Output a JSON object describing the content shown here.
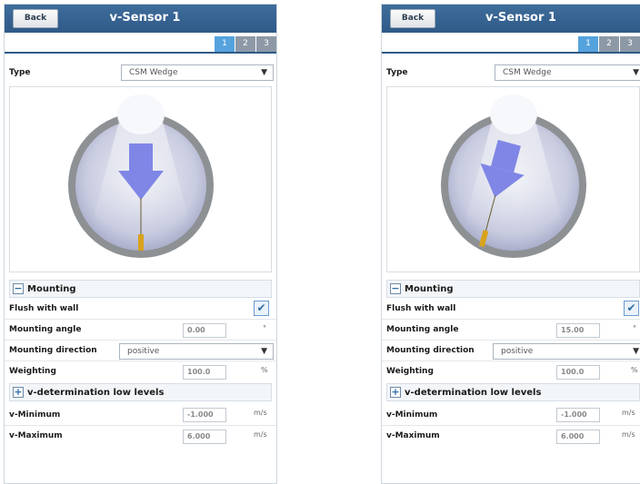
{
  "panels": [
    {
      "back_label": "Back",
      "title": "v-Sensor 1",
      "tabs": [
        "1",
        "2",
        "3"
      ],
      "type_label": "Type",
      "type_value": "CSM Wedge",
      "diagram": {
        "beam_angle_deg": 0
      },
      "mounting_section": "Mounting",
      "flush_label": "Flush with wall",
      "flush_checked": "✔",
      "angle_label": "Mounting angle",
      "angle_value": "0.00",
      "angle_unit": "°",
      "direction_label": "Mounting direction",
      "direction_value": "positive",
      "weighting_label": "Weighting",
      "weighting_value": "100.0",
      "weighting_unit": "%",
      "vdet_section": "v-determination low levels",
      "vmin_label": "v-Minimum",
      "vmin_value": "-1.000",
      "vmin_unit": "m/s",
      "vmax_label": "v-Maximum",
      "vmax_value": "6.000",
      "vmax_unit": "m/s"
    },
    {
      "back_label": "Back",
      "title": "v-Sensor 1",
      "tabs": [
        "1",
        "2",
        "3"
      ],
      "type_label": "Type",
      "type_value": "CSM Wedge",
      "diagram": {
        "beam_angle_deg": 15
      },
      "mounting_section": "Mounting",
      "flush_label": "Flush with wall",
      "flush_checked": "✔",
      "angle_label": "Mounting angle",
      "angle_value": "15.00",
      "angle_unit": "°",
      "direction_label": "Mounting direction",
      "direction_value": "positive",
      "weighting_label": "Weighting",
      "weighting_value": "100.0",
      "weighting_unit": "%",
      "vdet_section": "v-determination low levels",
      "vmin_label": "v-Minimum",
      "vmin_value": "-1.000",
      "vmin_unit": "m/s",
      "vmax_label": "v-Maximum",
      "vmax_value": "6.000",
      "vmax_unit": "m/s"
    }
  ],
  "colors": {
    "titlebar": "#2f5a88",
    "tab_active": "#55a3dd",
    "tab_inactive": "#8d99a6",
    "arrow": "#7f86e6",
    "pipe_ring": "#8e9194",
    "sensor": "#d8a21c"
  }
}
